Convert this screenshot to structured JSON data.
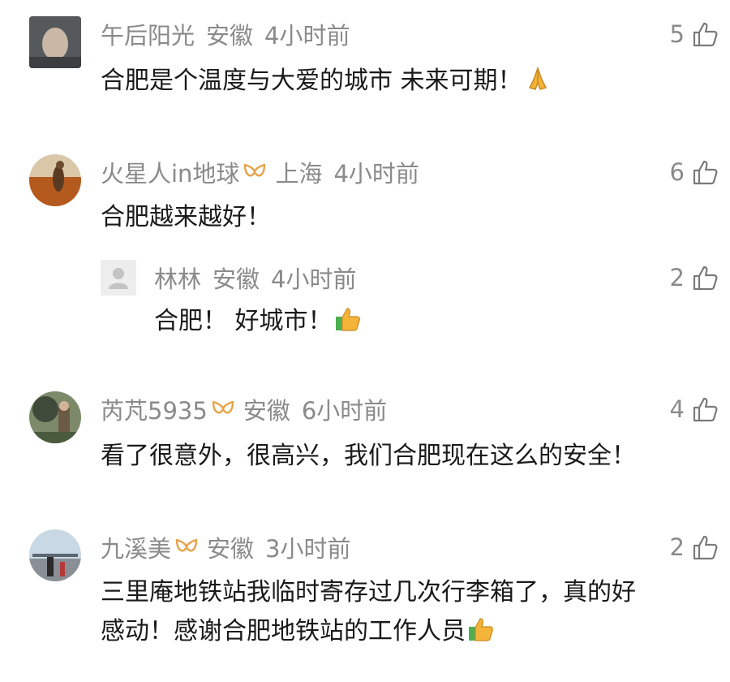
{
  "colors": {
    "meta_text": "#8a8a8a",
    "body_text": "#1a1a1a",
    "badge_gold": "#e7a34a",
    "emoji_yellow": "#f4b43a",
    "emoji_green": "#4caf50"
  },
  "comments": [
    {
      "username": "午后阳光",
      "location": "安徽",
      "time": "4小时前",
      "likes": "5",
      "text": "合肥是个温度与大爱的城市  未来可期！",
      "emoji": "folded-hands"
    },
    {
      "username": "火星人in地球",
      "location": "上海",
      "time": "4小时前",
      "likes": "6",
      "text": "合肥越来越好！",
      "badge": "gold-badge"
    },
    {
      "username": "林林",
      "location": "安徽",
      "time": "4小时前",
      "likes": "2",
      "text": "合肥！ 好城市！",
      "emoji": "thumbs-up",
      "reply": true
    },
    {
      "username": "芮芃5935",
      "location": "安徽",
      "time": "6小时前",
      "likes": "4",
      "text": "看了很意外，很高兴，我们合肥现在这么的安全！",
      "badge": "gold-badge"
    },
    {
      "username": "九溪美",
      "location": "安徽",
      "time": "3小时前",
      "likes": "2",
      "text_line1": "三里庵地铁站我临时寄存过几次行李箱了，真的好",
      "text_line2": "感动！感谢合肥地铁站的工作人员",
      "emoji": "thumbs-up",
      "badge": "gold-badge"
    }
  ]
}
